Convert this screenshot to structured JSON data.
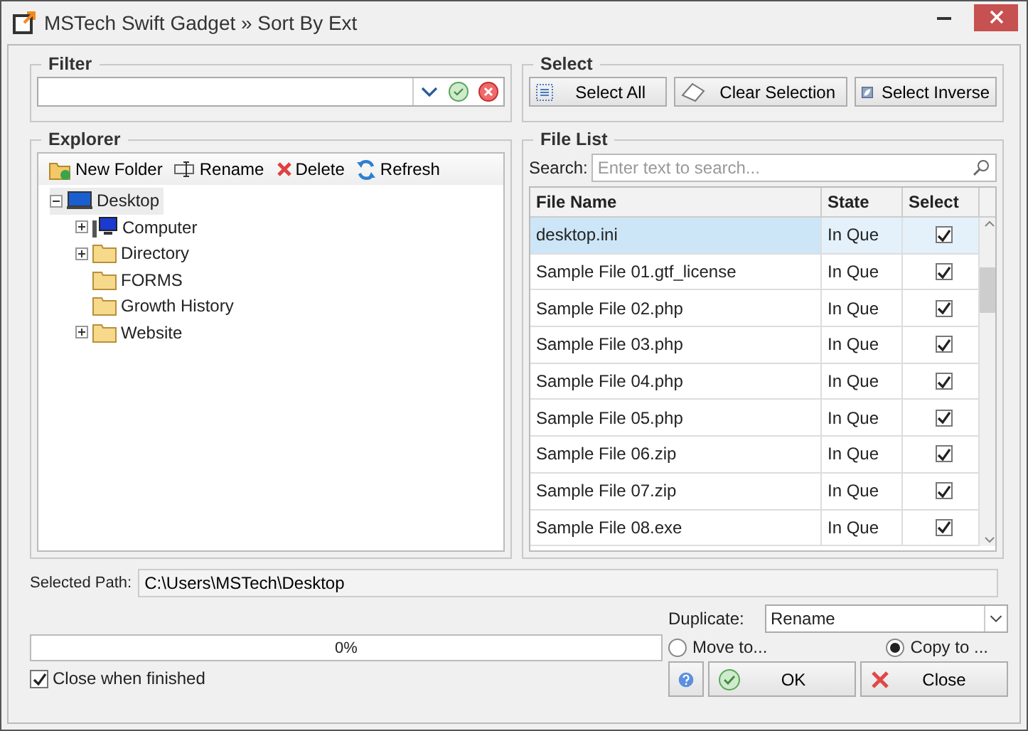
{
  "window": {
    "title": "MSTech Swift Gadget » Sort By Ext"
  },
  "filter": {
    "legend": "Filter"
  },
  "select": {
    "legend": "Select",
    "buttons": [
      {
        "label": "Select All",
        "kind": "all"
      },
      {
        "label": "Clear Selection",
        "kind": "clear"
      },
      {
        "label": "Select Inverse",
        "kind": "inverse"
      }
    ]
  },
  "explorer": {
    "legend": "Explorer",
    "toolbar": [
      {
        "label": "New Folder",
        "kind": "new"
      },
      {
        "label": "Rename",
        "kind": "rename"
      },
      {
        "label": "Delete",
        "kind": "delete"
      },
      {
        "label": "Refresh",
        "kind": "refresh"
      }
    ],
    "tree": [
      {
        "label": "Desktop",
        "kind": "desktop",
        "expanded": true,
        "selected": true,
        "children": [
          {
            "label": "Computer",
            "kind": "computer",
            "expanded": false,
            "selected": false
          },
          {
            "label": "Directory",
            "kind": "folder",
            "expanded": false,
            "selected": false
          },
          {
            "label": "FORMS",
            "kind": "folder",
            "selected": false
          },
          {
            "label": "Growth History",
            "kind": "folder",
            "selected": false
          },
          {
            "label": "Website",
            "kind": "folder",
            "expanded": false,
            "selected": false
          }
        ]
      }
    ]
  },
  "file_list": {
    "legend": "File List",
    "search_label": "Search:",
    "search_placeholder": "Enter text to search...",
    "columns": [
      "File Name",
      "State",
      "Select"
    ],
    "rows": [
      {
        "name": "desktop.ini",
        "state": "In Que",
        "checked": true,
        "selected": true
      },
      {
        "name": "Sample File 01.gtf_license",
        "state": "In Que",
        "checked": true,
        "selected": false
      },
      {
        "name": "Sample File 02.php",
        "state": "In Que",
        "checked": true,
        "selected": false
      },
      {
        "name": "Sample File 03.php",
        "state": "In Que",
        "checked": true,
        "selected": false
      },
      {
        "name": "Sample File 04.php",
        "state": "In Que",
        "checked": true,
        "selected": false
      },
      {
        "name": "Sample File 05.php",
        "state": "In Que",
        "checked": true,
        "selected": false
      },
      {
        "name": "Sample File 06.zip",
        "state": "In Que",
        "checked": true,
        "selected": false
      },
      {
        "name": "Sample File 07.zip",
        "state": "In Que",
        "checked": true,
        "selected": false
      },
      {
        "name": "Sample File 08.exe",
        "state": "In Que",
        "checked": true,
        "selected": false
      }
    ]
  },
  "selected_path": {
    "label": "Selected Path:",
    "value": "C:\\Users\\MSTech\\Desktop"
  },
  "duplicate": {
    "label": "Duplicate:",
    "value": "Rename"
  },
  "progress": {
    "level": 0,
    "text": "0%"
  },
  "mode": [
    {
      "label": "Move to...",
      "selected": false
    },
    {
      "label": "Copy to ...",
      "selected": true
    }
  ],
  "close_when_finished": {
    "label": "Close when finished",
    "checked": true
  },
  "buttons": [
    {
      "kind": "help"
    },
    {
      "kind": "ok",
      "label": "OK"
    },
    {
      "kind": "close",
      "label": "Close"
    }
  ]
}
